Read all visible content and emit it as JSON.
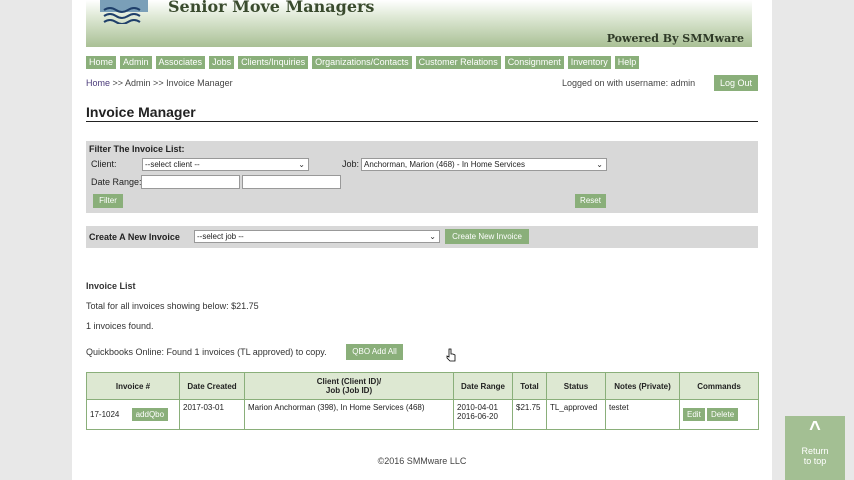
{
  "header": {
    "brand": "Senior Move Managers",
    "powered_by": "Powered By SMMware"
  },
  "nav": {
    "items": [
      "Home",
      "Admin",
      "Associates",
      "Jobs",
      "Clients/Inquiries",
      "Organizations/Contacts",
      "Customer Relations",
      "Consignment",
      "Inventory",
      "Help"
    ]
  },
  "breadcrumb": {
    "home": "Home",
    "rest": ">> Admin >> Invoice Manager"
  },
  "session": {
    "login_text": "Logged on with username: admin",
    "logout_label": "Log Out"
  },
  "page_title": "Invoice Manager",
  "filter": {
    "heading": "Filter The Invoice List:",
    "client_label": "Client:",
    "client_value": "--select client --",
    "job_label": "Job:",
    "job_value": "Anchorman, Marion (468) - In Home Services",
    "date_range_label": "Date Range:",
    "filter_button": "Filter",
    "reset_button": "Reset"
  },
  "create": {
    "label": "Create A New Invoice",
    "job_value": "--select job --",
    "button": "Create New Invoice"
  },
  "invoice_list": {
    "heading": "Invoice List",
    "total_text": "Total for all invoices showing below: $21.75",
    "found_text": "1 invoices found.",
    "qbo_text": "Quickbooks Online: Found 1 invoices (TL approved) to copy.",
    "qbo_button": "QBO Add All"
  },
  "table": {
    "headers": [
      "Invoice #",
      "Date Created",
      "Client (Client ID)/",
      "Job (Job ID)",
      "Date Range",
      "Total",
      "Status",
      "Notes (Private)",
      "Commands"
    ],
    "rows": [
      {
        "invoice": "17-1024",
        "add_qbo": "addQbo",
        "date_created": "2017-03-01",
        "client_job": "Marion Anchorman (398), In Home Services (468)",
        "date_start": "2010-04-01",
        "date_end": "2016-06-20",
        "total": "$21.75",
        "status": "TL_approved",
        "notes": "testet",
        "edit": "Edit",
        "delete": "Delete"
      }
    ]
  },
  "footer": "©2016 SMMware LLC",
  "return_to_top": {
    "arrow": "^",
    "line1": "Return",
    "line2": "to top"
  },
  "colors": {
    "accent": "#8aaf7a",
    "header_green": "#a9c095",
    "panel": "#d8d8d8"
  }
}
